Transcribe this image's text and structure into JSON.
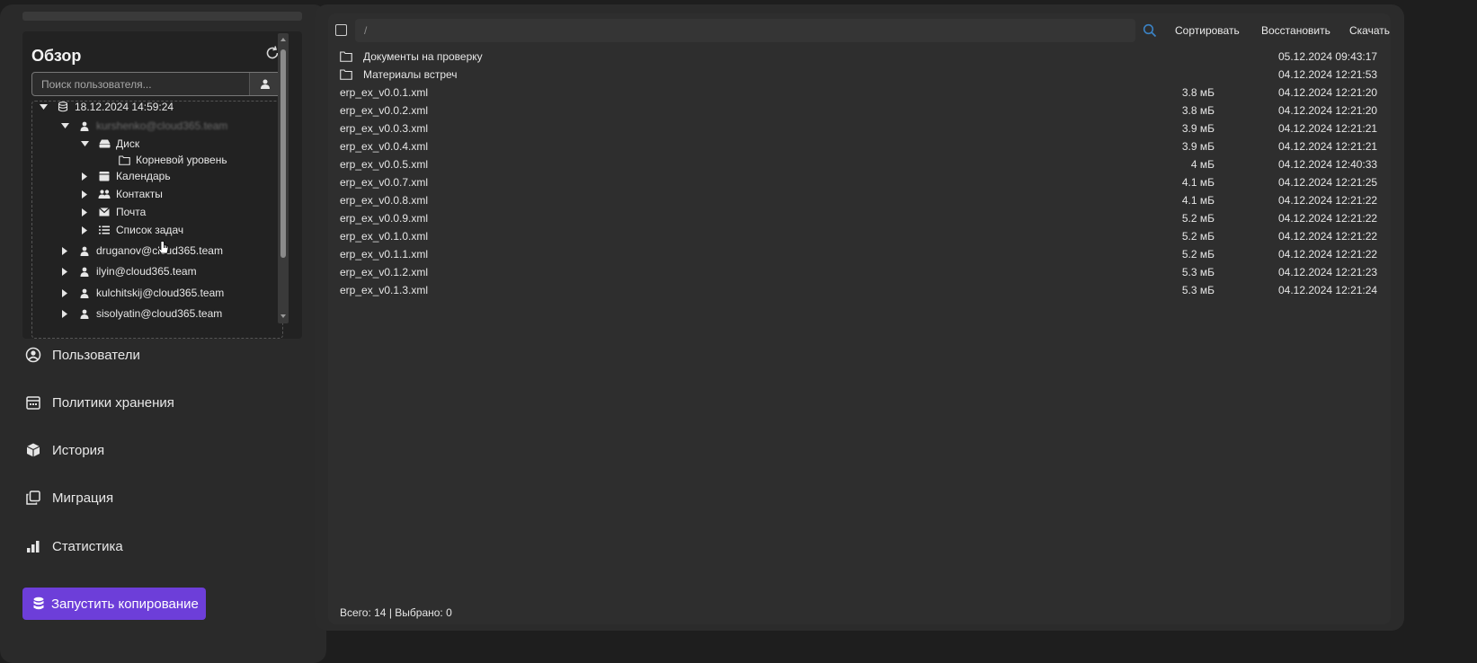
{
  "sidebar": {
    "overview_title": "Обзор",
    "search_placeholder": "Поиск пользователя...",
    "tree": [
      {
        "label": "18.12.2024 14:59:24",
        "icon": "database-icon",
        "level": 0,
        "expanded": true
      },
      {
        "label": "kurshenko@cloud365.team",
        "icon": "user-icon",
        "level": 1,
        "expanded": true,
        "blurred": true
      },
      {
        "label": "Диск",
        "icon": "drive-icon",
        "level": 2,
        "expanded": true
      },
      {
        "label": "Корневой уровень",
        "icon": "folder-icon",
        "level": 3,
        "expanded": null
      },
      {
        "label": "Календарь",
        "icon": "calendar-icon",
        "level": 2,
        "expanded": false
      },
      {
        "label": "Контакты",
        "icon": "contacts-icon",
        "level": 2,
        "expanded": false
      },
      {
        "label": "Почта",
        "icon": "mail-icon",
        "level": 2,
        "expanded": false
      },
      {
        "label": "Список задач",
        "icon": "tasklist-icon",
        "level": 2,
        "expanded": false
      },
      {
        "label": "druganov@cloud365.team",
        "icon": "user-icon",
        "level": 1,
        "expanded": false
      },
      {
        "label": "ilyin@cloud365.team",
        "icon": "user-icon",
        "level": 1,
        "expanded": false
      },
      {
        "label": "kulchitskij@cloud365.team",
        "icon": "user-icon",
        "level": 1,
        "expanded": false
      },
      {
        "label": "sisolyatin@cloud365.team",
        "icon": "user-icon",
        "level": 1,
        "expanded": false
      }
    ],
    "nav": {
      "users": "Пользователи",
      "retention": "Политики хранения",
      "history": "История",
      "migration": "Миграция",
      "stats": "Статистика"
    },
    "start_button": "Запустить копирование",
    "accent_color": "#6d3ed9"
  },
  "main": {
    "path_placeholder": "/",
    "toolbar": {
      "sort": "Сортировать",
      "restore": "Восстановить",
      "download": "Скачать"
    },
    "files": [
      {
        "name": "Документы на проверку",
        "size": "",
        "date": "05.12.2024 09:43:17",
        "type": "folder"
      },
      {
        "name": "Материалы встреч",
        "size": "",
        "date": "04.12.2024 12:21:53",
        "type": "folder"
      },
      {
        "name": "erp_ex_v0.0.1.xml",
        "size": "3.8 мБ",
        "date": "04.12.2024 12:21:20",
        "type": "file"
      },
      {
        "name": "erp_ex_v0.0.2.xml",
        "size": "3.8 мБ",
        "date": "04.12.2024 12:21:20",
        "type": "file"
      },
      {
        "name": "erp_ex_v0.0.3.xml",
        "size": "3.9 мБ",
        "date": "04.12.2024 12:21:21",
        "type": "file"
      },
      {
        "name": "erp_ex_v0.0.4.xml",
        "size": "3.9 мБ",
        "date": "04.12.2024 12:21:21",
        "type": "file"
      },
      {
        "name": "erp_ex_v0.0.5.xml",
        "size": "4 мБ",
        "date": "04.12.2024 12:40:33",
        "type": "file"
      },
      {
        "name": "erp_ex_v0.0.7.xml",
        "size": "4.1 мБ",
        "date": "04.12.2024 12:21:25",
        "type": "file"
      },
      {
        "name": "erp_ex_v0.0.8.xml",
        "size": "4.1 мБ",
        "date": "04.12.2024 12:21:22",
        "type": "file"
      },
      {
        "name": "erp_ex_v0.0.9.xml",
        "size": "5.2 мБ",
        "date": "04.12.2024 12:21:22",
        "type": "file"
      },
      {
        "name": "erp_ex_v0.1.0.xml",
        "size": "5.2 мБ",
        "date": "04.12.2024 12:21:22",
        "type": "file"
      },
      {
        "name": "erp_ex_v0.1.1.xml",
        "size": "5.2 мБ",
        "date": "04.12.2024 12:21:22",
        "type": "file"
      },
      {
        "name": "erp_ex_v0.1.2.xml",
        "size": "5.3 мБ",
        "date": "04.12.2024 12:21:23",
        "type": "file"
      },
      {
        "name": "erp_ex_v0.1.3.xml",
        "size": "5.3 мБ",
        "date": "04.12.2024 12:21:24",
        "type": "file"
      }
    ],
    "status": "Всего: 14 | Выбрано: 0",
    "search_icon_color": "#3b82c4"
  }
}
